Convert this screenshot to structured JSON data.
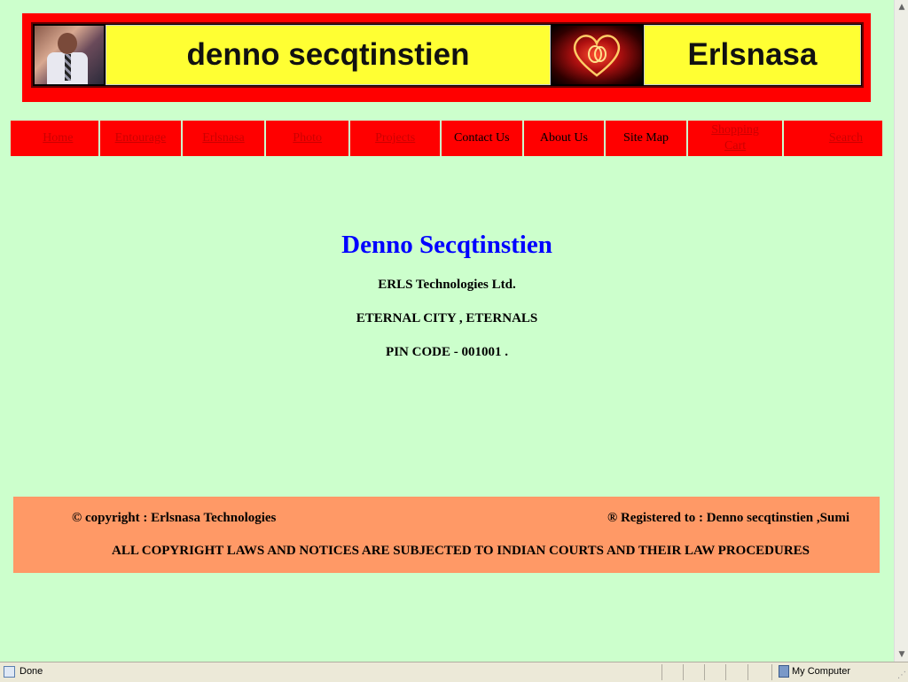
{
  "banner": {
    "title_left": "denno secqtinstien",
    "title_right": "Erlsnasa"
  },
  "nav": {
    "items": [
      {
        "label": "Home",
        "link": true
      },
      {
        "label": "Entourage",
        "link": true
      },
      {
        "label": "Erlsnasa",
        "link": true
      },
      {
        "label": "Photo",
        "link": true
      },
      {
        "label": "Projects",
        "link": true
      },
      {
        "label": "Contact Us",
        "link": false
      },
      {
        "label": "About Us",
        "link": false
      },
      {
        "label": "Site Map",
        "link": false
      },
      {
        "label": "Shopping Cart",
        "link": true
      },
      {
        "label": "Search",
        "link": true
      }
    ]
  },
  "content": {
    "title": "Denno Secqtinstien",
    "address_line1": "ERLS Technologies Ltd.",
    "address_line2": "ETERNAL CITY , ETERNALS",
    "address_line3": "PIN CODE - 001001 ."
  },
  "footer": {
    "copyright": "© copyright : Erlsnasa Technologies",
    "registered": "® Registered to : Denno secqtinstien ,Sumi",
    "legal": "ALL COPYRIGHT LAWS AND NOTICES ARE SUBJECTED TO INDIAN COURTS AND THEIR LAW PROCEDURES"
  },
  "statusbar": {
    "status": "Done",
    "zone": "My Computer"
  },
  "colors": {
    "page_bg": "#ccffcc",
    "banner_red": "#ff0000",
    "title_yellow": "#ffff33",
    "heading_blue": "#0000ff",
    "footer_orange": "#ff9966"
  },
  "icons": [
    "person-photo",
    "glowing-heart-image",
    "page-status-icon",
    "computer-zone-icon"
  ]
}
